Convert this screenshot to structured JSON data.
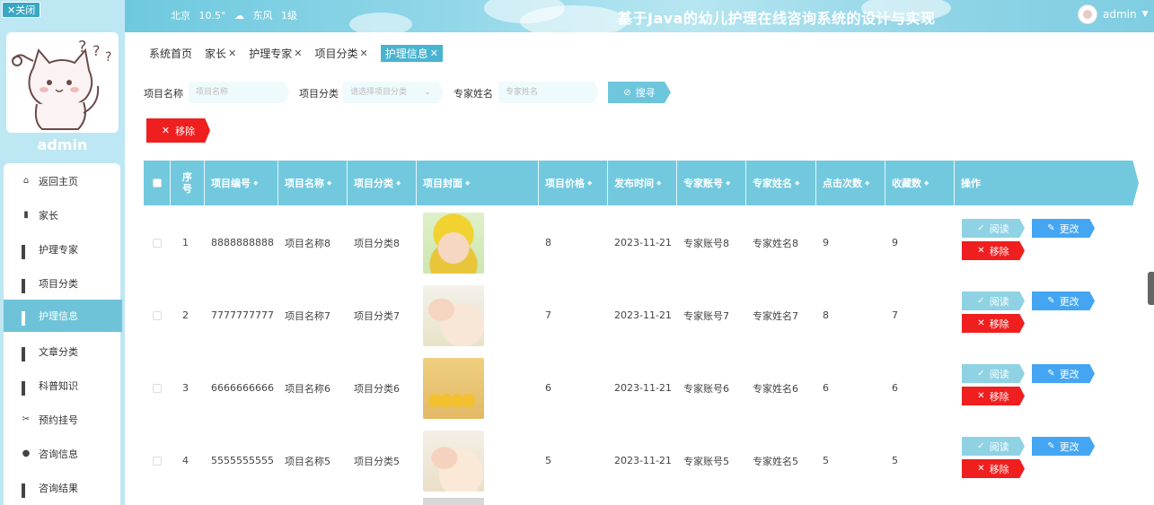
{
  "topbar": {
    "close_label": "关闭",
    "weather": {
      "city": "北京",
      "temp": "10.5°",
      "wind_dir": "东风",
      "wind_level": "1级"
    },
    "title": "基于Java的幼儿护理在线咨询系统的设计与实现",
    "user": "admin"
  },
  "sidebar": {
    "admin_name": "admin",
    "items": [
      {
        "label": "返回主页",
        "icon": "home-icon"
      },
      {
        "label": "家长",
        "icon": "chart-icon"
      },
      {
        "label": "护理专家",
        "icon": "grid-icon"
      },
      {
        "label": "项目分类",
        "icon": "grid-icon"
      },
      {
        "label": "护理信息",
        "icon": "grid-icon"
      },
      {
        "label": "文章分类",
        "icon": "grid-icon"
      },
      {
        "label": "科普知识",
        "icon": "grid-icon"
      },
      {
        "label": "预约挂号",
        "icon": "scissors-icon"
      },
      {
        "label": "咨询信息",
        "icon": "user-icon"
      },
      {
        "label": "咨询结果",
        "icon": "grid-icon"
      }
    ],
    "active_index": 4
  },
  "tabs": [
    {
      "label": "系统首页",
      "closable": false
    },
    {
      "label": "家长",
      "closable": true
    },
    {
      "label": "护理专家",
      "closable": true
    },
    {
      "label": "项目分类",
      "closable": true
    },
    {
      "label": "护理信息",
      "closable": true,
      "active": true
    }
  ],
  "search": {
    "name_label": "项目名称",
    "name_placeholder": "项目名称",
    "category_label": "项目分类",
    "category_placeholder": "请选择项目分类",
    "expert_label": "专家姓名",
    "expert_placeholder": "专家姓名",
    "search_button": "搜寻"
  },
  "actions": {
    "remove_label": "移除"
  },
  "table": {
    "headers": [
      "序号",
      "项目编号",
      "项目名称",
      "项目分类",
      "项目封面",
      "项目价格",
      "发布时间",
      "专家账号",
      "专家姓名",
      "点击次数",
      "收藏数",
      "操作"
    ],
    "rows": [
      {
        "index": "1",
        "code": "8888888888",
        "name": "项目名称8",
        "category": "项目分类8",
        "price": "8",
        "date": "2023-11-21",
        "account": "专家账号8",
        "expert": "专家姓名8",
        "clicks": "9",
        "favorites": "9"
      },
      {
        "index": "2",
        "code": "7777777777",
        "name": "项目名称7",
        "category": "项目分类7",
        "price": "7",
        "date": "2023-11-21",
        "account": "专家账号7",
        "expert": "专家姓名7",
        "clicks": "8",
        "favorites": "7"
      },
      {
        "index": "3",
        "code": "6666666666",
        "name": "项目名称6",
        "category": "项目分类6",
        "price": "6",
        "date": "2023-11-21",
        "account": "专家账号6",
        "expert": "专家姓名6",
        "clicks": "6",
        "favorites": "6"
      },
      {
        "index": "4",
        "code": "5555555555",
        "name": "项目名称5",
        "category": "项目分类5",
        "price": "5",
        "date": "2023-11-21",
        "account": "专家账号5",
        "expert": "专家姓名5",
        "clicks": "5",
        "favorites": "5"
      }
    ],
    "op_read": "阅读",
    "op_edit": "更改",
    "op_delete": "移除"
  },
  "colors": {
    "accent": "#72c9de",
    "danger": "#ef1f1f",
    "edit": "#44a6f2",
    "read": "#8fd2e4"
  }
}
